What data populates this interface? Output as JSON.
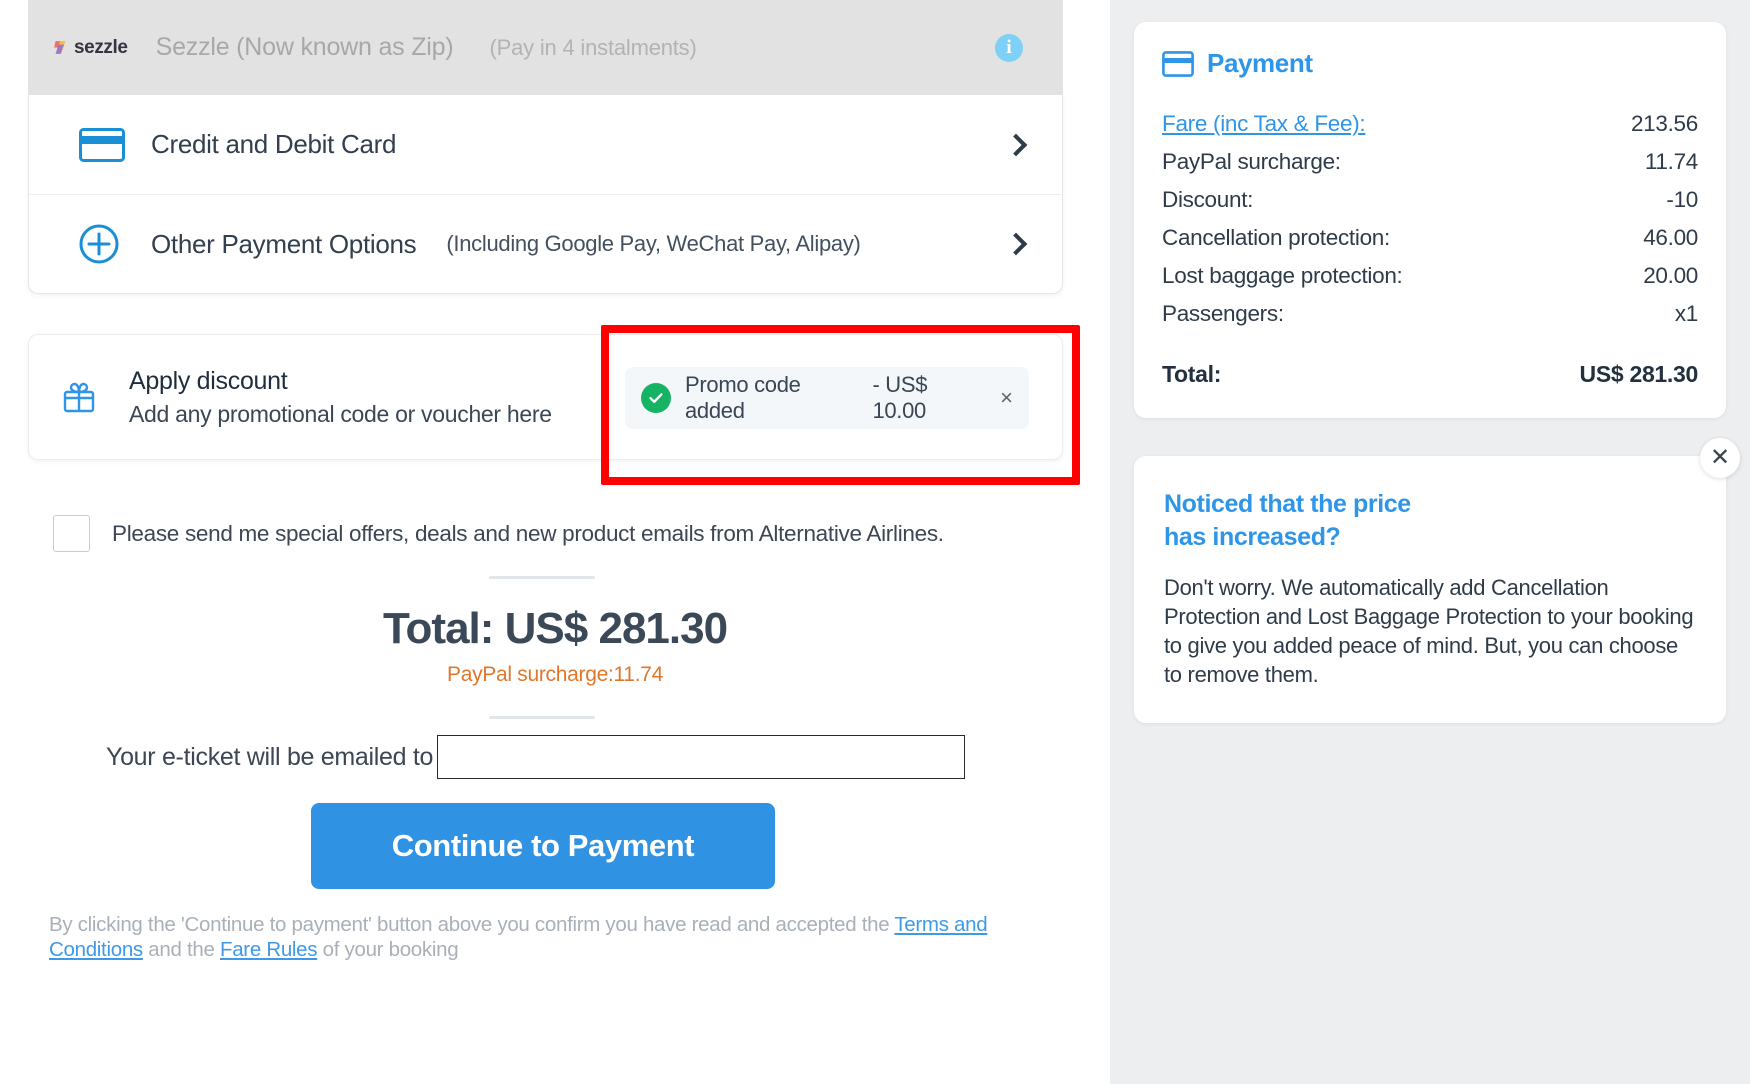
{
  "payment_methods": {
    "sezzle": {
      "logo_word": "sezzle",
      "name": "Sezzle (Now known as Zip)",
      "note": "(Pay in 4 instalments)",
      "info_glyph": "i"
    },
    "rows": [
      {
        "label": "Credit and Debit Card",
        "sub": "",
        "icon": "credit-card-icon"
      },
      {
        "label": "Other Payment Options",
        "sub": "(Including Google Pay, WeChat Pay, Alipay)",
        "icon": "plus-circle-icon"
      }
    ]
  },
  "discount": {
    "title": "Apply discount",
    "subtitle": "Add any promotional code or voucher here",
    "promo": {
      "status": "Promo code added",
      "amount": "- US$ 10.00",
      "remove": "×"
    }
  },
  "offers": {
    "label": "Please send me special offers, deals and new product emails from Alternative Airlines.",
    "checked": false
  },
  "summary": {
    "total_heading": "Total: US$ 281.30",
    "surcharge_note": "PayPal surcharge:11.74"
  },
  "email": {
    "label": "Your e-ticket will be emailed to",
    "value": "",
    "placeholder": ""
  },
  "cta": {
    "label": "Continue to Payment"
  },
  "terms": {
    "part1": "By clicking the 'Continue to payment' button above you confirm you have read and accepted the ",
    "link1": "Terms and Conditions",
    "part2": " and the ",
    "link2": "Fare Rules",
    "part3": " of your booking"
  },
  "sidebar": {
    "payment_panel": {
      "title": "Payment",
      "items": [
        {
          "label": "Fare (inc Tax & Fee):",
          "value": "213.56",
          "is_link": true
        },
        {
          "label": "PayPal surcharge:",
          "value": "11.74",
          "is_link": false
        },
        {
          "label": "Discount:",
          "value": "-10",
          "is_link": false
        },
        {
          "label": "Cancellation protection:",
          "value": "46.00",
          "is_link": false
        },
        {
          "label": "Lost baggage protection:",
          "value": "20.00",
          "is_link": false
        },
        {
          "label": "Passengers:",
          "value": "x1",
          "is_link": false
        }
      ],
      "total_label": "Total:",
      "total_value": "US$ 281.30"
    },
    "notice_panel": {
      "title_line1": "Noticed that the price",
      "title_line2": "has increased?",
      "body": "Don't worry. We automatically add Cancellation Protection and Lost Baggage Protection to your booking to give you added peace of mind. But, you can choose to remove them.",
      "close": "✕"
    }
  },
  "colors": {
    "accent_blue": "#2e95e8",
    "cta_blue": "#3092e3",
    "orange": "#e2762a",
    "green": "#16b364",
    "highlight_red": "#ff0000",
    "sidebar_bg": "#eceef0",
    "disabled_row_bg": "#e2e2e2"
  }
}
